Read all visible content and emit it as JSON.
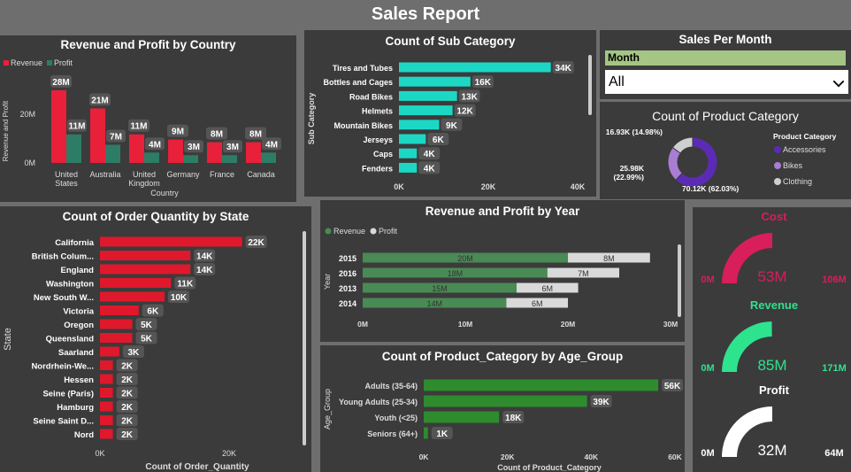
{
  "report_title": "Sales Report",
  "colors": {
    "revenue": "#e8203a",
    "profit": "#2d7d66",
    "subcat": "#1dd7c5",
    "state": "#e0182c",
    "year_rev": "#4a8a55",
    "year_profit": "#d9d9d9",
    "age": "#2e8b2e",
    "cost": "#d81e5b",
    "revenue_gauge": "#2de38e",
    "profit_gauge": "#ffffff",
    "accessories": "#5b2bb5",
    "bikes": "#a97dd4",
    "clothing": "#cfcfcf"
  },
  "country_chart": {
    "title": "Revenue and Profit by Country",
    "legend": [
      "Revenue",
      "Profit"
    ],
    "ylabel": "Revenue and Profit",
    "xlabel": "Country",
    "y_ticks": [
      "20M",
      "0M"
    ],
    "categories": [
      "United States",
      "Australia",
      "United Kingdom",
      "Germany",
      "France",
      "Canada"
    ],
    "revenue": [
      28,
      21,
      11,
      9,
      8,
      8
    ],
    "profit": [
      11,
      7,
      4,
      3,
      3,
      4
    ],
    "revenue_labels": [
      "28M",
      "21M",
      "11M",
      "9M",
      "8M",
      "8M"
    ],
    "profit_labels": [
      "11M",
      "7M",
      "4M",
      "3M",
      "3M",
      "4M"
    ],
    "ymax": 30
  },
  "subcat_chart": {
    "title": "Count of Sub Category",
    "ylabel": "Sub Category",
    "categories": [
      "Tires and Tubes",
      "Bottles and Cages",
      "Road Bikes",
      "Helmets",
      "Mountain Bikes",
      "Jerseys",
      "Caps",
      "Fenders"
    ],
    "values": [
      34,
      16,
      13,
      12,
      9,
      6,
      4,
      4
    ],
    "labels": [
      "34K",
      "16K",
      "13K",
      "12K",
      "9K",
      "6K",
      "4K",
      "4K"
    ],
    "x_ticks": [
      "0K",
      "20K",
      "40K"
    ],
    "xmax": 40
  },
  "slicer": {
    "title": "Sales Per Month",
    "label": "Month",
    "value": "All"
  },
  "product_category": {
    "title": "Count of Product Category",
    "legend_title": "Product Category",
    "categories": [
      "Accessories",
      "Bikes",
      "Clothing"
    ],
    "values": [
      70.12,
      25.98,
      16.93
    ],
    "labels": [
      "70.12K (62.03%)",
      "25.98K (22.99%)",
      "16.93K (14.98%)"
    ]
  },
  "state_chart": {
    "title": "Count of Order Quantity by State",
    "ylabel": "State",
    "xlabel": "Count of Order_Quantity",
    "categories": [
      "California",
      "British Colum...",
      "England",
      "Washington",
      "New South W...",
      "Victoria",
      "Oregon",
      "Queensland",
      "Saarland",
      "Nordrhein-We...",
      "Hessen",
      "Seine (Paris)",
      "Hamburg",
      "Seine Saint D...",
      "Nord"
    ],
    "values": [
      22,
      14,
      14,
      11,
      10,
      6,
      5,
      5,
      3,
      2,
      2,
      2,
      2,
      2,
      2
    ],
    "labels": [
      "22K",
      "14K",
      "14K",
      "11K",
      "10K",
      "6K",
      "5K",
      "5K",
      "3K",
      "2K",
      "2K",
      "2K",
      "2K",
      "2K",
      "2K"
    ],
    "x_ticks": [
      "0K",
      "20K"
    ],
    "xmax": 24
  },
  "year_chart": {
    "title": "Revenue and Profit by Year",
    "legend": [
      "Revenue",
      "Profit"
    ],
    "ylabel": "Year",
    "categories": [
      "2015",
      "2016",
      "2013",
      "2014"
    ],
    "revenue": [
      20,
      18,
      15,
      14
    ],
    "profit": [
      8,
      7,
      6,
      6
    ],
    "revenue_labels": [
      "20M",
      "18M",
      "15M",
      "14M"
    ],
    "profit_labels": [
      "8M",
      "7M",
      "6M",
      "6M"
    ],
    "x_ticks": [
      "0M",
      "10M",
      "20M",
      "30M"
    ],
    "xmax": 30
  },
  "age_chart": {
    "title": "Count of Product_Category by Age_Group",
    "ylabel": "Age_Group",
    "xlabel": "Count of Product_Category",
    "categories": [
      "Adults (35-64)",
      "Young Adults (25-34)",
      "Youth (<25)",
      "Seniors (64+)"
    ],
    "values": [
      56,
      39,
      18,
      1
    ],
    "labels": [
      "56K",
      "39K",
      "18K",
      "1K"
    ],
    "x_ticks": [
      "0K",
      "20K",
      "40K",
      "60K"
    ],
    "xmax": 60
  },
  "gauges": [
    {
      "title": "Cost",
      "value": 53,
      "min": 0,
      "max": 106,
      "value_label": "53M",
      "min_label": "0M",
      "max_label": "106M"
    },
    {
      "title": "Revenue",
      "value": 85,
      "min": 0,
      "max": 171,
      "value_label": "85M",
      "min_label": "0M",
      "max_label": "171M"
    },
    {
      "title": "Profit",
      "value": 32,
      "min": 0,
      "max": 64,
      "value_label": "32M",
      "min_label": "0M",
      "max_label": "64M"
    }
  ]
}
